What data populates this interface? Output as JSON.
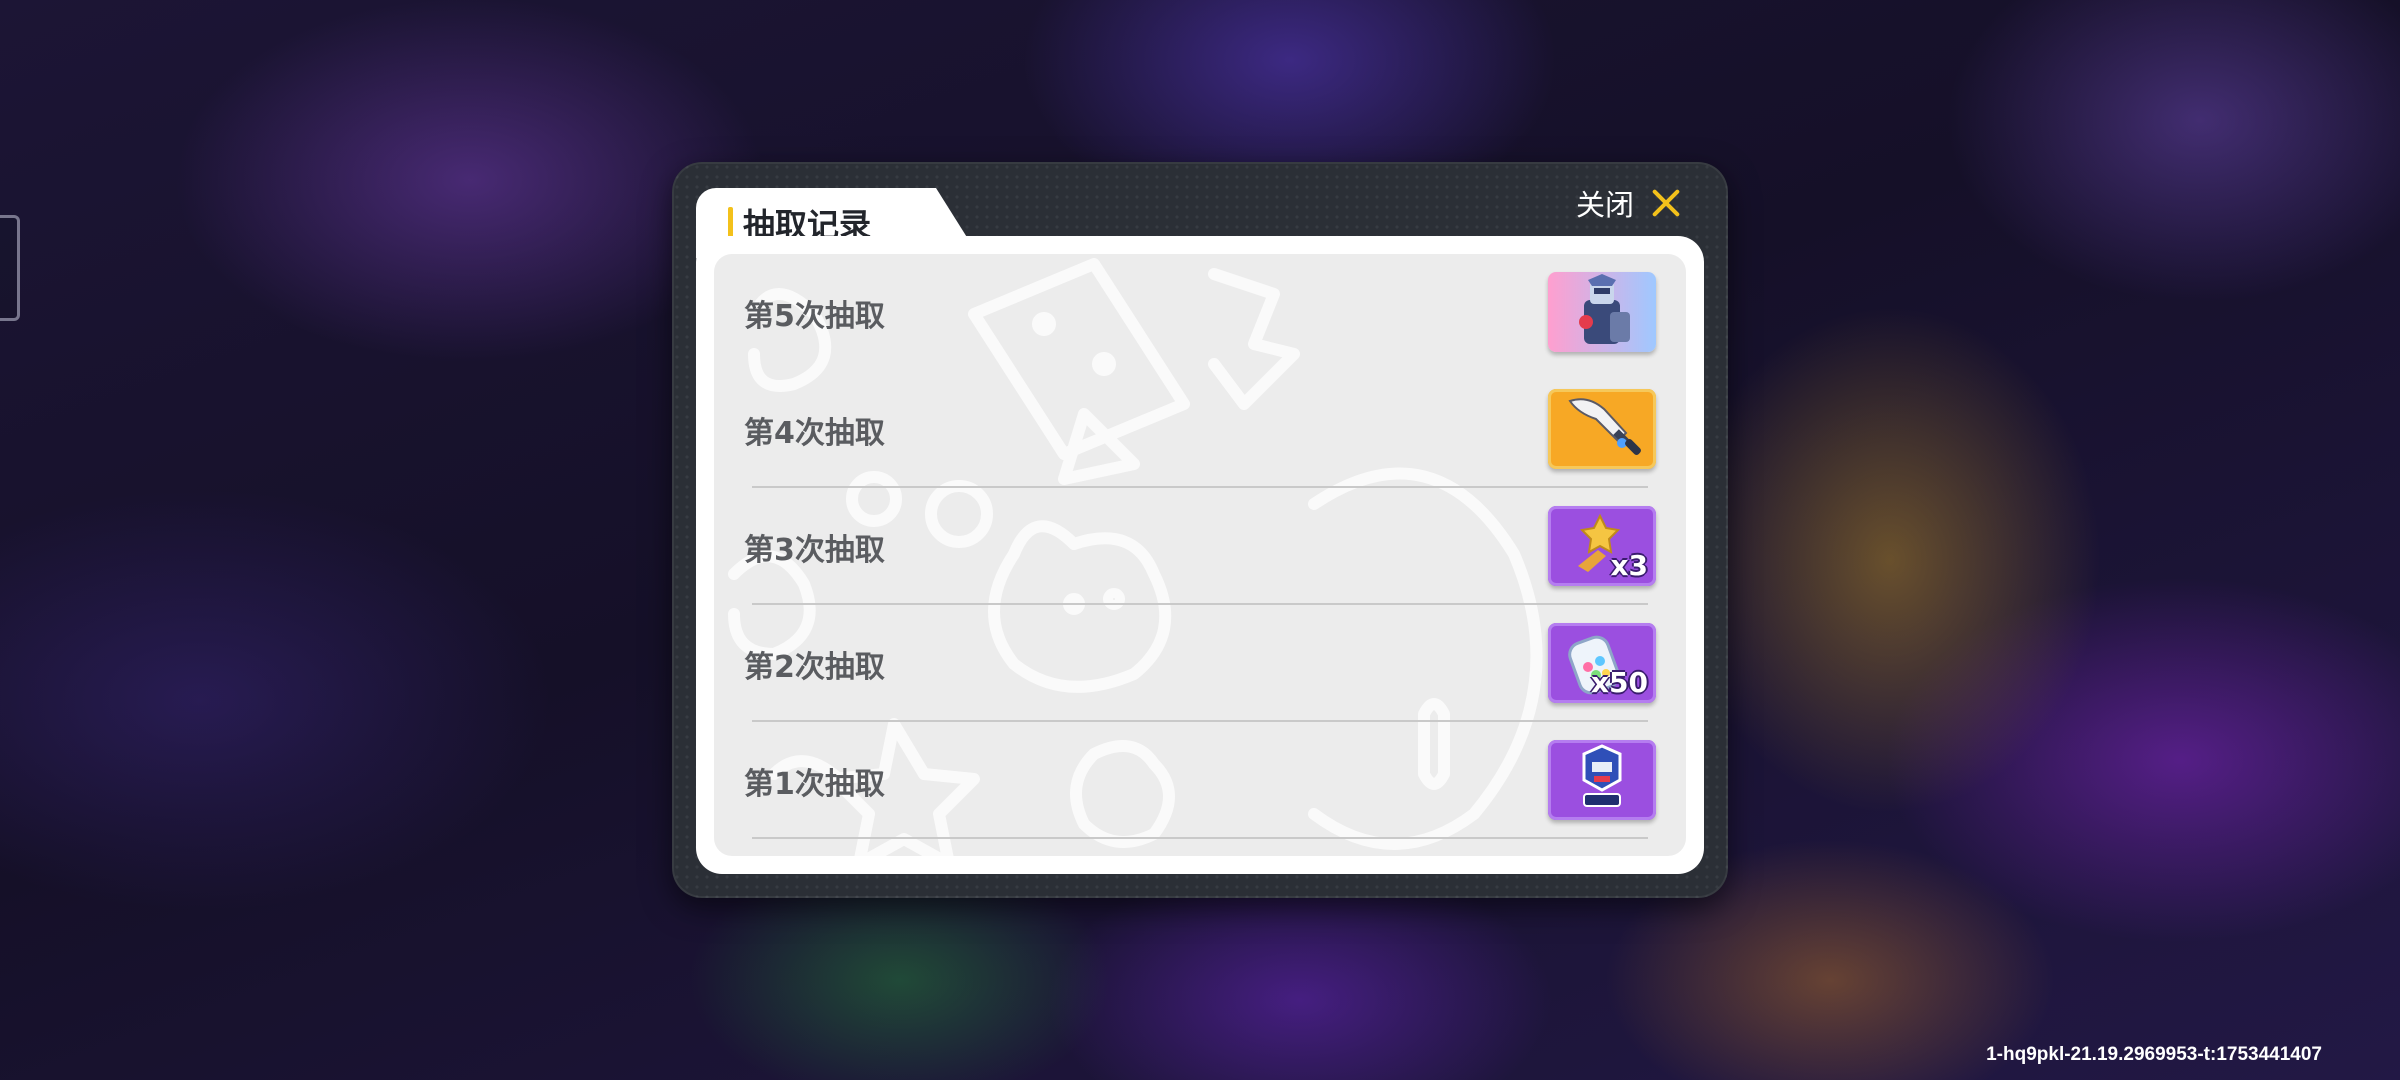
{
  "dialog": {
    "title": "抽取记录",
    "close_label": "关闭"
  },
  "records": [
    {
      "label": "第5次抽取",
      "reward_icon": "robot-hero-icon",
      "rarity_color": "#b8a0e8",
      "quantity": ""
    },
    {
      "label": "第4次抽取",
      "reward_icon": "sword-icon",
      "rarity_color": "#f5a623",
      "quantity": ""
    },
    {
      "label": "第3次抽取",
      "reward_icon": "star-figure-icon",
      "rarity_color": "#9b4fe0",
      "quantity": "x3"
    },
    {
      "label": "第2次抽取",
      "reward_icon": "candy-jar-icon",
      "rarity_color": "#9b4fe0",
      "quantity": "x50"
    },
    {
      "label": "第1次抽取",
      "reward_icon": "robot-head-icon",
      "rarity_color": "#9b4fe0",
      "quantity": ""
    }
  ],
  "footer": {
    "version_text": "1-hq9pkl-21.19.2969953-t:1753441407"
  }
}
